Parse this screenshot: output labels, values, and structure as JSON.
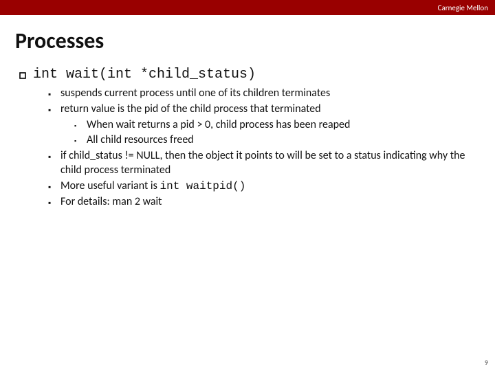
{
  "header": {
    "org": "Carnegie Mellon"
  },
  "title": "Processes",
  "signature": "int wait(int *child_status)",
  "bullets": [
    {
      "text": "suspends current process until one of its children terminates"
    },
    {
      "text": "return value is the pid of the child process that terminated",
      "sub": [
        "When wait returns a pid > 0, child process has been reaped",
        "All child resources freed"
      ]
    },
    {
      "text": "if child_status != NULL, then the object it points to will be set to  a status indicating why the child process terminated"
    },
    {
      "pre": "More useful variant is ",
      "code": "int waitpid()"
    },
    {
      "text": "For details: man 2 wait"
    }
  ],
  "page": "9"
}
